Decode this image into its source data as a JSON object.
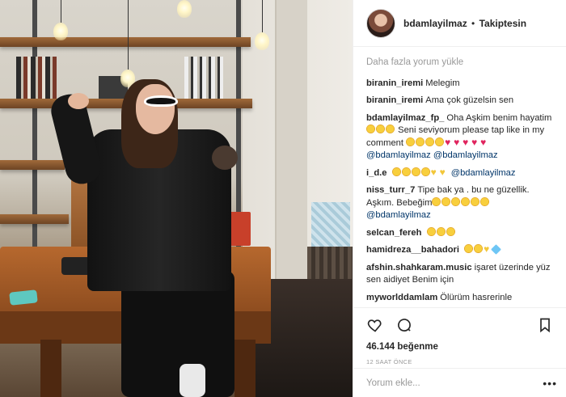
{
  "post": {
    "username": "bdamlayilmaz",
    "separator": "•",
    "follow_status": "Takiptesin"
  },
  "comments_section": {
    "load_more": "Daha fazla yorum yükle",
    "comments": [
      {
        "user": "biranin_iremi",
        "text": "Melegim"
      },
      {
        "user": "biranin_iremi",
        "text": "Ama çok güzelsin sen"
      },
      {
        "user": "bdamlayilmaz_fp_",
        "text": "Oha Aşkim benim hayatim",
        "text2": "Seni seviyorum please tap like in my comment",
        "mention1": "@bdamlayilmaz",
        "mention2": "@bdamlayilmaz"
      },
      {
        "user": "i_d.e",
        "mention": "@bdamlayilmaz"
      },
      {
        "user": "niss_turr_7",
        "text": "Tipe bak ya . bu ne güzellik. Aşkım. Bebeğim",
        "mention": "@bdamlayilmaz"
      },
      {
        "user": "selcan_fereh"
      },
      {
        "user": "hamidreza__bahadori"
      },
      {
        "user": "afshin.shahkaram.music",
        "text": "işaret üzerinde yüz sen aidiyet Benim için"
      },
      {
        "user": "myworlddamlam",
        "text": "Ölürüm hasrerinle"
      }
    ]
  },
  "actions": {
    "like_icon": "heart-icon",
    "comment_icon": "comment-bubble-icon",
    "save_icon": "bookmark-icon",
    "likes": "46.144 beğenme",
    "time": "12 SAAT ÖNCE"
  },
  "add_comment": {
    "placeholder": "Yorum ekle...",
    "more": "•••"
  },
  "colors": {
    "text": "#262626",
    "muted": "#999999",
    "mention": "#003569",
    "border": "#efefef"
  }
}
